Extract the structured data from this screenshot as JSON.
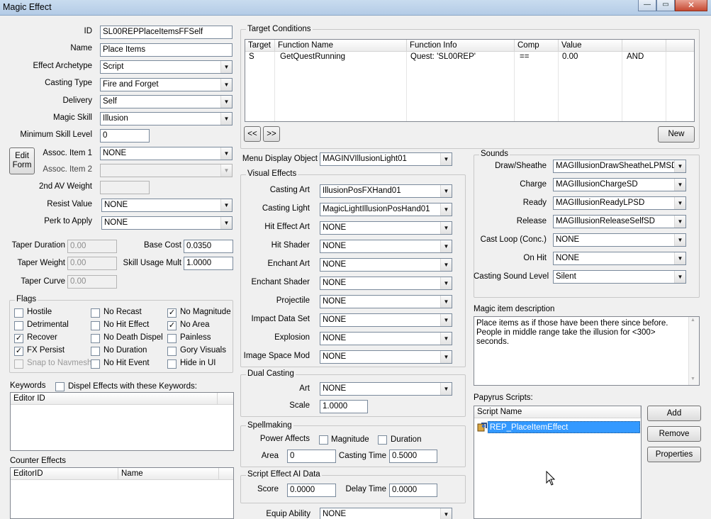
{
  "window": {
    "title": "Magic Effect",
    "minimize": "—",
    "maximize": "▭",
    "close": "✕"
  },
  "left": {
    "id_label": "ID",
    "id_value": "SL00REPPlaceItemsFFSelf",
    "name_label": "Name",
    "name_value": "Place Items",
    "archetype_label": "Effect Archetype",
    "archetype_value": "Script",
    "casting_type_label": "Casting Type",
    "casting_type_value": "Fire and Forget",
    "delivery_label": "Delivery",
    "delivery_value": "Self",
    "magic_skill_label": "Magic Skill",
    "magic_skill_value": "Illusion",
    "min_skill_label": "Minimum Skill Level",
    "min_skill_value": "0",
    "edit_form_line1": "Edit",
    "edit_form_line2": "Form",
    "assoc1_label": "Assoc. Item 1",
    "assoc1_value": "NONE",
    "assoc2_label": "Assoc. Item 2",
    "assoc2_value": "",
    "av_weight_label": "2nd AV Weight",
    "av_weight_value": "",
    "resist_label": "Resist Value",
    "resist_value": "NONE",
    "perk_label": "Perk to Apply",
    "perk_value": "NONE",
    "taper_duration_label": "Taper Duration",
    "taper_duration_value": "0.00",
    "base_cost_label": "Base Cost",
    "base_cost_value": "0.0350",
    "taper_weight_label": "Taper Weight",
    "taper_weight_value": "0.00",
    "skill_mult_label": "Skill Usage Mult",
    "skill_mult_value": "1.0000",
    "taper_curve_label": "Taper Curve",
    "taper_curve_value": "0.00"
  },
  "flags": {
    "title": "Flags",
    "items": [
      {
        "label": "Hostile",
        "checked": false,
        "disabled": false
      },
      {
        "label": "No Recast",
        "checked": false,
        "disabled": false
      },
      {
        "label": "No Magnitude",
        "checked": true,
        "disabled": false
      },
      {
        "label": "Detrimental",
        "checked": false,
        "disabled": false
      },
      {
        "label": "No Hit Effect",
        "checked": false,
        "disabled": false
      },
      {
        "label": "No Area",
        "checked": true,
        "disabled": false
      },
      {
        "label": "Recover",
        "checked": true,
        "disabled": false
      },
      {
        "label": "No Death Dispel",
        "checked": false,
        "disabled": false
      },
      {
        "label": "Painless",
        "checked": false,
        "disabled": false
      },
      {
        "label": "FX Persist",
        "checked": true,
        "disabled": false
      },
      {
        "label": "No Duration",
        "checked": false,
        "disabled": false
      },
      {
        "label": "Gory Visuals",
        "checked": false,
        "disabled": false
      },
      {
        "label": "Snap to Navmesh",
        "checked": false,
        "disabled": true
      },
      {
        "label": "No Hit Event",
        "checked": false,
        "disabled": false
      },
      {
        "label": "Hide in UI",
        "checked": false,
        "disabled": false
      }
    ]
  },
  "keywords": {
    "title": "Keywords",
    "dispel_label": "Dispel Effects with these Keywords:",
    "col": "Editor ID"
  },
  "counter": {
    "title": "Counter Effects",
    "col1": "EditorID",
    "col2": "Name"
  },
  "target": {
    "title": "Target Conditions",
    "columns": [
      "Target",
      "Function Name",
      "Function Info",
      "Comp",
      "Value",
      ""
    ],
    "row": [
      "S",
      "GetQuestRunning",
      "Quest: 'SL00REP'",
      "==",
      "0.00",
      "AND"
    ],
    "prev": "<<",
    "next": ">>",
    "new": "New"
  },
  "menu_display": {
    "label": "Menu Display Object",
    "value": "MAGINVIllusionLight01"
  },
  "visual": {
    "title": "Visual Effects",
    "rows": [
      {
        "label": "Casting Art",
        "value": "IllusionPosFXHand01"
      },
      {
        "label": "Casting Light",
        "value": "MagicLightIllusionPosHand01"
      },
      {
        "label": "Hit Effect Art",
        "value": "NONE"
      },
      {
        "label": "Hit Shader",
        "value": "NONE"
      },
      {
        "label": "Enchant Art",
        "value": "NONE"
      },
      {
        "label": "Enchant Shader",
        "value": "NONE"
      },
      {
        "label": "Projectile",
        "value": "NONE"
      },
      {
        "label": "Impact Data Set",
        "value": "NONE"
      },
      {
        "label": "Explosion",
        "value": "NONE"
      },
      {
        "label": "Image Space Mod",
        "value": "NONE"
      }
    ]
  },
  "dual": {
    "title": "Dual Casting",
    "art_label": "Art",
    "art_value": "NONE",
    "scale_label": "Scale",
    "scale_value": "1.0000"
  },
  "spell": {
    "title": "Spellmaking",
    "power_label": "Power Affects",
    "magnitude": "Magnitude",
    "duration": "Duration",
    "area_label": "Area",
    "area_value": "0",
    "cast_time_label": "Casting Time",
    "cast_time_value": "0.5000"
  },
  "ai": {
    "title": "Script Effect AI Data",
    "score_label": "Score",
    "score_value": "0.0000",
    "delay_label": "Delay Time",
    "delay_value": "0.0000"
  },
  "equip": {
    "label": "Equip Ability",
    "value": "NONE"
  },
  "sounds": {
    "title": "Sounds",
    "rows": [
      {
        "label": "Draw/Sheathe",
        "value": "MAGIllusionDrawSheatheLPMSD"
      },
      {
        "label": "Charge",
        "value": "MAGIllusionChargeSD"
      },
      {
        "label": "Ready",
        "value": "MAGIllusionReadyLPSD"
      },
      {
        "label": "Release",
        "value": "MAGIllusionReleaseSelfSD"
      },
      {
        "label": "Cast Loop (Conc.)",
        "value": "NONE"
      },
      {
        "label": "On Hit",
        "value": "NONE"
      },
      {
        "label": "Casting Sound Level",
        "value": "Silent"
      }
    ]
  },
  "description": {
    "title": "Magic item description",
    "text": "Place items as if those have been there since before. People in middle range take the illusion for <300> seconds."
  },
  "papyrus": {
    "title": "Papyrus Scripts:",
    "col": "Script Name",
    "script": "REP_PlaceItemEffect",
    "add": "Add",
    "remove": "Remove",
    "properties": "Properties"
  }
}
